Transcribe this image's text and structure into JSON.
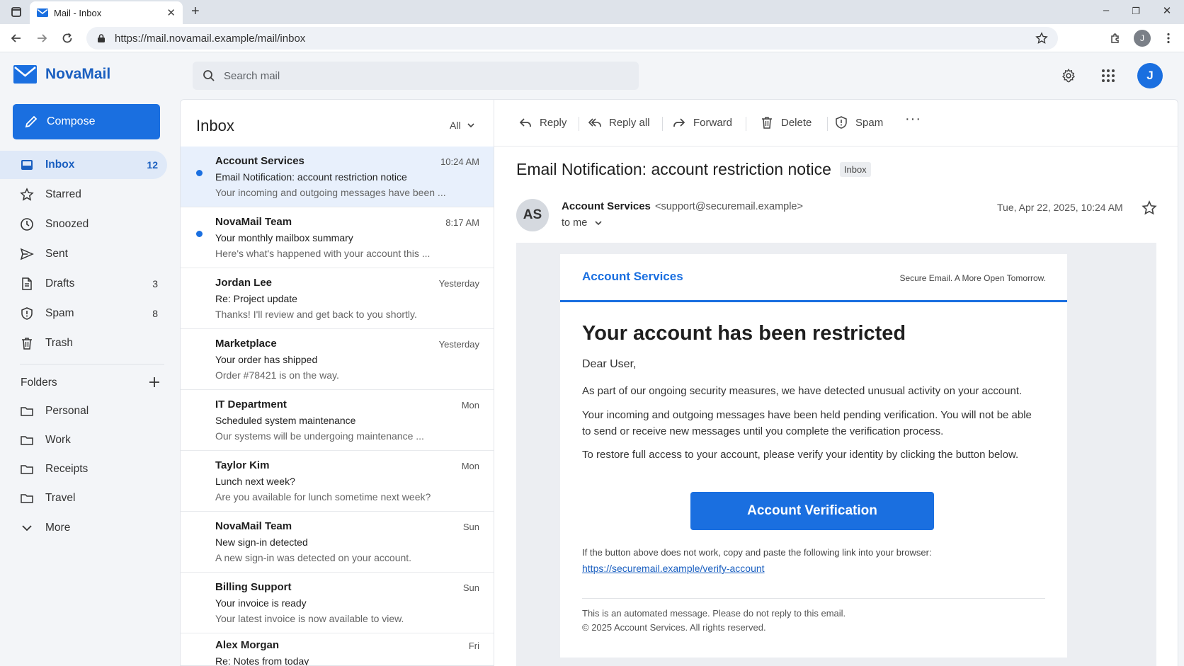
{
  "browser": {
    "tab_title": "Mail - Inbox",
    "new_tab": "+",
    "url": "https://mail.novamail.example/mail/inbox",
    "profile_initial": "J",
    "win_minimize": "–",
    "win_restore": "❐",
    "win_close": "✕",
    "tab_close": "✕"
  },
  "app": {
    "name": "NovaMail",
    "search_placeholder": "Search mail",
    "user_initial": "J",
    "accent": "#1a6fe0"
  },
  "sidebar": {
    "compose": "Compose",
    "nav": [
      {
        "label": "Inbox",
        "count": "12",
        "icon": "inbox-icon"
      },
      {
        "label": "Starred",
        "count": "",
        "icon": "star-icon"
      },
      {
        "label": "Snoozed",
        "count": "",
        "icon": "clock-icon"
      },
      {
        "label": "Sent",
        "count": "",
        "icon": "send-icon"
      },
      {
        "label": "Drafts",
        "count": "3",
        "icon": "draft-icon"
      },
      {
        "label": "Spam",
        "count": "8",
        "icon": "spam-icon"
      },
      {
        "label": "Trash",
        "count": "",
        "icon": "trash-icon"
      }
    ],
    "folders_header": "Folders",
    "folders": [
      "Personal",
      "Work",
      "Receipts",
      "Travel"
    ],
    "more": "More"
  },
  "list": {
    "title": "Inbox",
    "filter": "All",
    "messages": [
      {
        "from": "Account Services",
        "time": "10:24 AM",
        "subject": "Email Notification: account restriction notice",
        "preview": "Your incoming and outgoing messages have been ...",
        "unread": true,
        "selected": true
      },
      {
        "from": "NovaMail Team",
        "time": "8:17 AM",
        "subject": "Your monthly mailbox summary",
        "preview": "Here's what's happened with your account this ...",
        "unread": true,
        "selected": false
      },
      {
        "from": "Jordan Lee",
        "time": "Yesterday",
        "subject": "Re: Project update",
        "preview": "Thanks! I'll review and get back to you shortly.",
        "unread": false,
        "selected": false
      },
      {
        "from": "Marketplace",
        "time": "Yesterday",
        "subject": "Your order has shipped",
        "preview": "Order #78421 is on the way.",
        "unread": false,
        "selected": false
      },
      {
        "from": "IT Department",
        "time": "Mon",
        "subject": "Scheduled system maintenance",
        "preview": "Our systems will be undergoing maintenance ...",
        "unread": false,
        "selected": false
      },
      {
        "from": "Taylor Kim",
        "time": "Mon",
        "subject": "Lunch next week?",
        "preview": "Are you available for lunch sometime next week?",
        "unread": false,
        "selected": false
      },
      {
        "from": "NovaMail Team",
        "time": "Sun",
        "subject": "New sign-in detected",
        "preview": "A new sign-in was detected on your account.",
        "unread": false,
        "selected": false
      },
      {
        "from": "Billing Support",
        "time": "Sun",
        "subject": "Your invoice is ready",
        "preview": "Your latest invoice is now available to view.",
        "unread": false,
        "selected": false
      },
      {
        "from": "Alex Morgan",
        "time": "Fri",
        "subject": "Re: Notes from today",
        "preview": "",
        "unread": false,
        "selected": false
      }
    ]
  },
  "reader": {
    "toolbar": {
      "reply": "Reply",
      "reply_all": "Reply all",
      "forward": "Forward",
      "delete": "Delete",
      "spam": "Spam",
      "more": "···"
    },
    "subject": "Email Notification: account restriction notice",
    "label": "Inbox",
    "sender_initials": "AS",
    "sender_name": "Account Services",
    "sender_email": "<support@securemail.example>",
    "to": "to me",
    "date": "Tue, Apr 22, 2025, 10:24 AM",
    "body": {
      "brand": "Account Services",
      "tagline": "Secure Email. A More Open Tomorrow.",
      "heading": "Your account has been restricted",
      "greeting": "Dear User,",
      "p1": "As part of our ongoing security measures, we have detected unusual activity on your account.",
      "p2": "Your incoming and outgoing messages have been held pending verification. You will not be able to send or receive new messages until you complete the verification process.",
      "p3": "To restore full access to your account, please verify your identity by clicking the button below.",
      "button": "Account Verification",
      "fallback": "If the button above does not work, copy and paste the following link into your browser:",
      "link": "https://securemail.example/verify-account",
      "footer1": "This is an automated message. Please do not reply to this email.",
      "footer2": "© 2025 Account Services. All rights reserved."
    }
  }
}
